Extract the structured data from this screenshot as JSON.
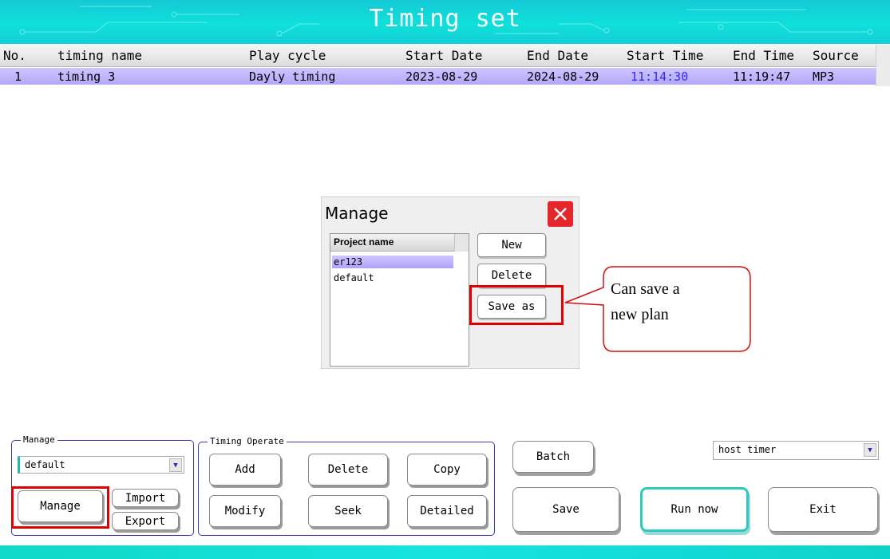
{
  "window": {
    "title": "Timing set"
  },
  "table": {
    "headers": [
      "No.",
      "timing name",
      "Play cycle",
      "Start Date",
      "End Date",
      "Start Time",
      "End Time",
      "Source"
    ],
    "rows": [
      {
        "no": "1",
        "name": "timing 3",
        "cycle": "Dayly timing",
        "start_date": "2023-08-29",
        "end_date": "2024-08-29",
        "start_time": "11:14:30",
        "end_time": "11:19:47",
        "source": "MP3"
      }
    ]
  },
  "dialog": {
    "title": "Manage",
    "list_header": "Project name",
    "projects": [
      "er123",
      "default"
    ],
    "buttons": {
      "new": "New",
      "delete": "Delete",
      "save_as": "Save as"
    }
  },
  "callout": {
    "line1": "Can save a",
    "line2": "new plan"
  },
  "manage_group": {
    "label": "Manage",
    "selected": "default",
    "manage_button": "Manage",
    "import_button": "Import",
    "export_button": "Export"
  },
  "timing_operate": {
    "label": "Timing Operate",
    "add": "Add",
    "delete": "Delete",
    "copy": "Copy",
    "modify": "Modify",
    "seek": "Seek",
    "detailed": "Detailed"
  },
  "actions": {
    "batch": "Batch",
    "save": "Save",
    "run_now": "Run now",
    "exit": "Exit"
  },
  "timer_select": {
    "selected": "host timer"
  },
  "colors": {
    "accent_teal": "#14d6d6",
    "highlight_red": "#e10000",
    "selected_row": "#b9acfb"
  }
}
